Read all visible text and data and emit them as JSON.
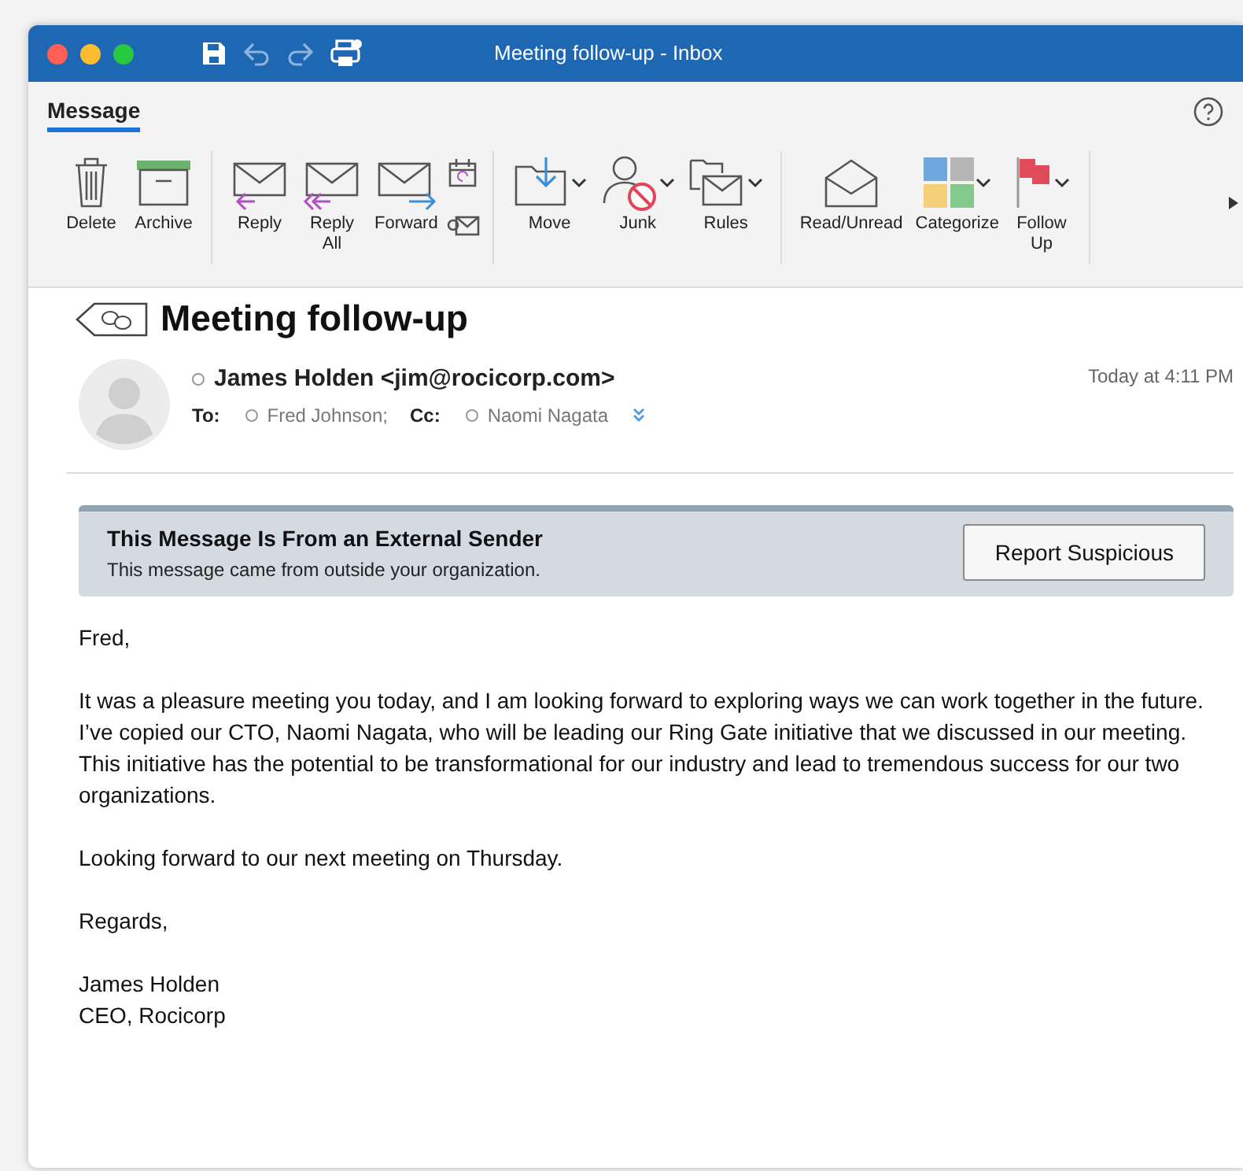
{
  "window": {
    "title": "Meeting follow-up - Inbox"
  },
  "tabs": [
    {
      "label": "Message",
      "selected": true
    }
  ],
  "ribbon": {
    "groups": [
      [
        {
          "kind": "delete",
          "label": "Delete",
          "dropdown": false
        },
        {
          "kind": "archive",
          "label": "Archive",
          "dropdown": false
        }
      ],
      [
        {
          "kind": "reply",
          "label": "Reply",
          "dropdown": false
        },
        {
          "kind": "replyall",
          "label": "Reply All",
          "dropdown": false
        },
        {
          "kind": "forward",
          "label": "Forward",
          "dropdown": false
        },
        {
          "kind": "extras"
        }
      ],
      [
        {
          "kind": "move",
          "label": "Move",
          "dropdown": true
        },
        {
          "kind": "junk",
          "label": "Junk",
          "dropdown": true
        },
        {
          "kind": "rules",
          "label": "Rules",
          "dropdown": true
        }
      ],
      [
        {
          "kind": "readunread",
          "label": "Read/Unread",
          "dropdown": false
        },
        {
          "kind": "categorize",
          "label": "Categorize",
          "dropdown": true
        },
        {
          "kind": "followup",
          "label": "Follow Up",
          "dropdown": true
        }
      ]
    ]
  },
  "message": {
    "subject": "Meeting follow-up",
    "sender": "James Holden <jim@rocicorp.com>",
    "time": "Today at 4:11 PM",
    "to_label": "To:",
    "to": [
      "Fred Johnson;"
    ],
    "cc_label": "Cc:",
    "cc": [
      "Naomi Nagata"
    ]
  },
  "banner": {
    "title": "This Message Is From an External Sender",
    "text": "This message came from outside your organization.",
    "button": "Report Suspicious"
  },
  "body": [
    "Fred,",
    "It was a pleasure meeting you today, and I am looking forward to exploring ways we can work together in the future. I’ve copied our CTO, Naomi Nagata, who will be leading our Ring Gate initiative that we discussed in our meeting. This initiative has the potential to be transformational for our industry and lead to tremendous success for our two organizations.",
    "Looking forward to our next meeting on Thursday.",
    "Regards,"
  ],
  "signature": [
    "James Holden",
    "CEO, Rocicorp"
  ]
}
